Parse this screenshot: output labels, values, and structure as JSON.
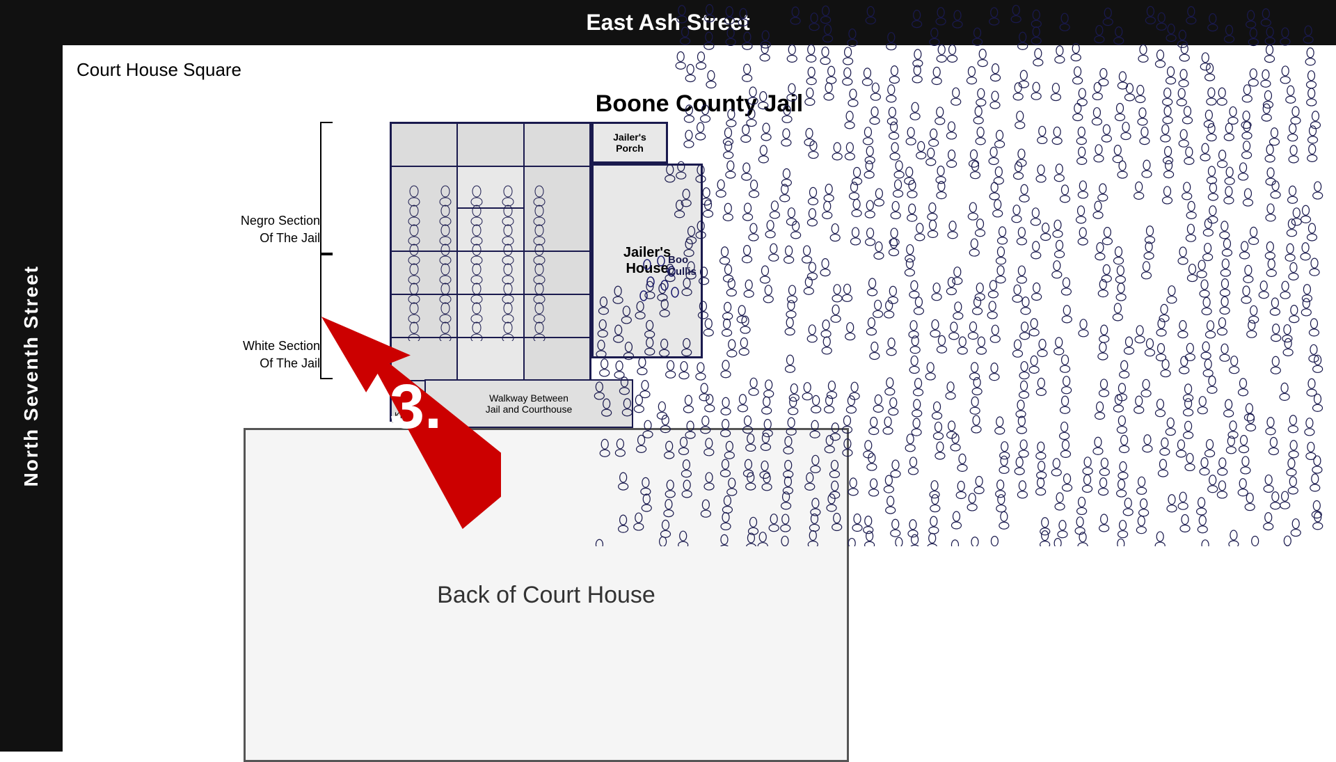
{
  "page": {
    "background_color": "#ffffff",
    "top_bar_color": "#111111",
    "left_bar_color": "#111111"
  },
  "header": {
    "east_ash_street": "East Ash Street",
    "north_seventh_street": "North Seventh Street"
  },
  "labels": {
    "court_house_square": "Court House Square",
    "boone_county_jail": "Boone County Jail",
    "negro_section": "Negro Section\nOf The Jail",
    "negro_section_line1": "Negro Section",
    "negro_section_line2": "Of The Jail",
    "white_section_line1": "White Section",
    "white_section_line2": "Of The Jail",
    "jailers_house": "Jailer's\nHouse",
    "jailers_porch": "Jailer's\nPorch",
    "walkway": "Walkway Between\nJail and Courthouse",
    "back_courthouse": "Back of Court House",
    "bystanders": "Boo Cullis",
    "arrow_number": "3."
  }
}
